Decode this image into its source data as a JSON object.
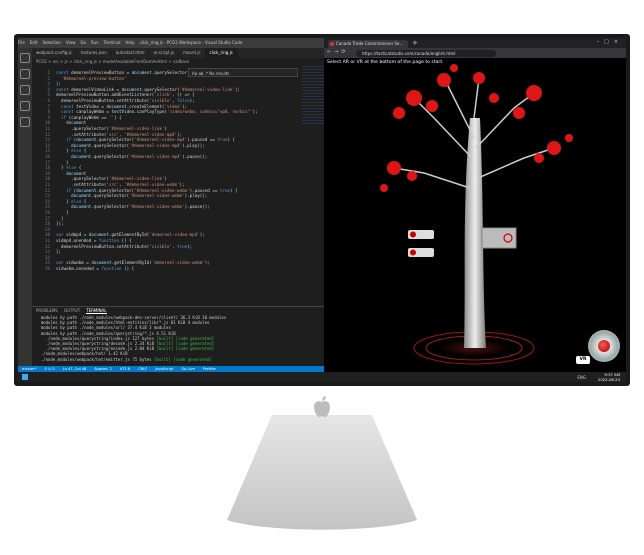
{
  "vscode": {
    "menu": [
      "File",
      "Edit",
      "Selection",
      "View",
      "Go",
      "Run",
      "Terminal",
      "Help"
    ],
    "title": "click_ring.js - PCO2 Workspace - Visual Studio Code",
    "tabs": [
      "webpack.config.js",
      "textures.json",
      "autostart.html",
      "ar.script.js",
      "mount.js",
      "click_ring.js"
    ],
    "breadcrumb": "PCO2 > src > js > click_ring.js > modelAvailableFromDomAsHtml > callback",
    "find_widget": "Aa ab .* No results",
    "code_lines": [
      "const demoreelPreviewButton = document.querySelector(",
      "  '#demoreel-preview-button'",
      ");",
      "const demoreelVideoLink = document.querySelector('#demoreel-video-link');",
      "demoreelPreviewButton.addEventListener('click', () => {",
      "  demoreelPreviewButton.setAttribute('visible', false);",
      "  const testVideo = document.createElement('video');",
      "  const canplayWebm = testVideo.canPlayType('video/webm; codecs=\"vp8, vorbis\"');",
      "  if (canplayWebm == '') {",
      "    document",
      "      .querySelector('#demoreel-video-link')",
      "      .setAttribute('src', '#demoreel-video-mp4');",
      "    if (document.querySelector('#demoreel-video-mp4').paused == true) {",
      "      document.querySelector('#demoreel-video-mp4').play();",
      "    } else {",
      "      document.querySelector('#demoreel-video-mp4').pause();",
      "    }",
      "  } else {",
      "    document",
      "      .querySelector('#demoreel-video-link')",
      "      .setAttribute('src', '#demoreel-video-webm');",
      "    if (document.querySelector('#demoreel-video-webm').paused == true) {",
      "      document.querySelector('#demoreel-video-webm').play();",
      "    } else {",
      "      document.querySelector('#demoreel-video-webm').pause();",
      "    }",
      "  }",
      "});",
      "",
      "var vidmp4 = document.getElementById('demoreel-video-mp4');",
      "vidmp4.onended = function () {",
      "  demoreelPreviewButton.setAttribute('visible', true);",
      "};",
      "",
      "var vidwebm = document.getElementById('demoreel-video-webm');",
      "vidwebm.onended = function () {"
    ],
    "line_start": 1,
    "panel_tabs": [
      "PROBLEMS",
      "OUTPUT",
      "TERMINAL"
    ],
    "panel_active": "TERMINAL",
    "terminal_lines": [
      "  modules by path ./node_modules/webpack-dev-server/client/ 36.3 KiB 10 modules",
      "  modules by path ./node_modules/html-entities/lib/*.js 81 KiB 4 modules",
      "  modules by path ./node_modules/url/ 37.4 KiB 3 modules",
      "  modules by path ./node_modules/querystring/*.js 4.51 KiB",
      "    ./node_modules/querystring/index.js 127 bytes [built] [code generated]",
      "    ./node_modules/querystring/decode.js 2.34 KiB [built] [code generated]",
      "    ./node_modules/querystring/encode.js 2.04 KiB [built] [code generated]",
      "  ./node_modules/webpack/hot/ 1.42 KiB",
      "  ./node_modules/webpack/hot/emitter.js 75 bytes [built] [code generated]"
    ],
    "status": [
      "master*",
      "0 ⚠ 0",
      "Ln 47, Col 48",
      "Spaces: 2",
      "UTF-8",
      "CRLF",
      "JavaScript",
      "Go Live",
      "Prettier"
    ]
  },
  "browser": {
    "tab_title": "Canada Trade Commissioner Se...",
    "url": "https://tasticatstudio.com/canada/english.html",
    "prompt": "Select AR or VR at the bottom of the page to start.",
    "vr_label": "VR"
  },
  "taskbar": {
    "time": "9:37 AM",
    "date": "2022-06-23",
    "lang": "ENG"
  }
}
